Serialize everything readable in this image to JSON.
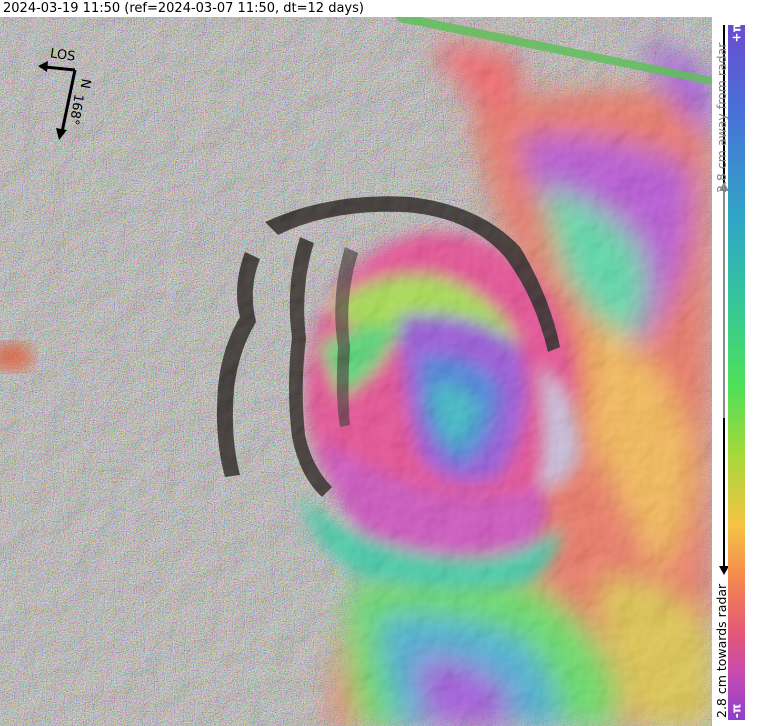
{
  "header": {
    "title": "2024-03-19 11:50 (ref=2024-03-07 11:50, dt=12 days)"
  },
  "compass": {
    "los_label": "LOS",
    "north_label": "N",
    "heading_label": "168°"
  },
  "colorbar": {
    "top_end": "+π",
    "bottom_end": "-π",
    "away_label": "2.8 cm away from radar",
    "towards_label": "2.8 cm towards radar"
  },
  "map": {
    "icons": [
      "interferogram-image"
    ]
  }
}
